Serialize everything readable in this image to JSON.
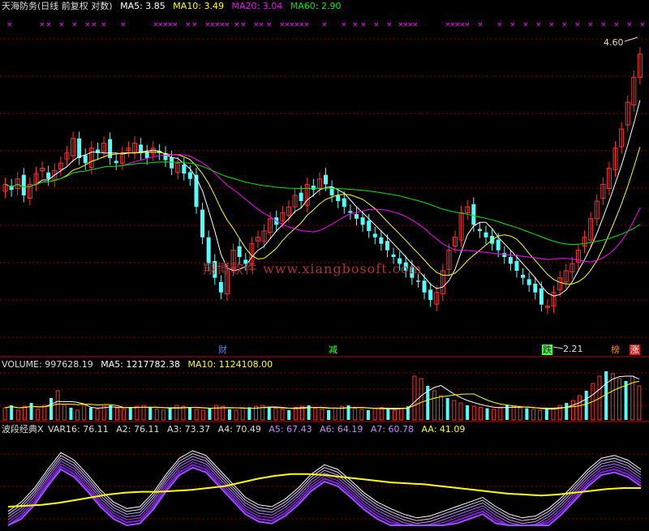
{
  "header": {
    "title": "天海防务(日线 前复权 对数)",
    "ma5": "MA5: 3.85",
    "ma10": "MA10: 3.49",
    "ma20": "MA20: 3.04",
    "ma60": "MA60: 2.90"
  },
  "volume_header": {
    "label": "VOLUME: 997628.19",
    "ma5": "MA5: 1217782.38",
    "ma10": "MA10: 1124108.00"
  },
  "indicator_header": {
    "name": "波段经典X",
    "var16": "VAR16: 76.11",
    "a2": "A2: 76.11",
    "a3": "A3: 73.37",
    "a4": "A4: 70.49",
    "a5": "A5: 67.43",
    "a6": "A6: 64.19",
    "a7": "A7: 60.78",
    "aa": "AA: 41.09"
  },
  "watermark": "翔博软件 www.xiangbosoft.com",
  "annotations": {
    "high": "4.60",
    "low": "2.21",
    "tags": [
      "财",
      "减",
      "跌",
      "榜",
      "涨"
    ]
  },
  "colors": {
    "up": "#ff3232",
    "down": "#54fcfc",
    "ma5": "#ffffff",
    "ma10": "#ffff00",
    "ma20": "#ff00ff",
    "ma60": "#00e600",
    "aa": "#ffff00",
    "grid": "#8b0000",
    "x_marker": "#ff00ff"
  },
  "chart_data": [
    {
      "type": "candlestick",
      "title": "天海防务(日线 前复权 对数)",
      "ylog": true,
      "y_marked_high": 4.6,
      "y_marked_low": 2.21,
      "closes_approx": [
        3.15,
        3.1,
        3.2,
        3.05,
        3.15,
        3.25,
        3.3,
        3.2,
        3.28,
        3.35,
        3.45,
        3.6,
        3.4,
        3.35,
        3.5,
        3.45,
        3.55,
        3.4,
        3.35,
        3.45,
        3.5,
        3.55,
        3.45,
        3.4,
        3.5,
        3.45,
        3.38,
        3.3,
        3.35,
        3.25,
        3.2,
        2.95,
        2.7,
        2.5,
        2.4,
        2.3,
        2.45,
        2.6,
        2.55,
        2.5,
        2.65,
        2.7,
        2.75,
        2.85,
        2.8,
        2.9,
        2.95,
        3.05,
        3.0,
        3.15,
        3.1,
        3.2,
        3.15,
        3.05,
        3.0,
        2.95,
        2.9,
        2.85,
        2.8,
        2.75,
        2.7,
        2.65,
        2.6,
        2.55,
        2.5,
        2.45,
        2.4,
        2.38,
        2.3,
        2.25,
        2.3,
        2.45,
        2.6,
        2.7,
        2.9,
        2.95,
        2.8,
        2.75,
        2.7,
        2.65,
        2.6,
        2.55,
        2.5,
        2.45,
        2.4,
        2.35,
        2.3,
        2.22,
        2.21,
        2.3,
        2.4,
        2.45,
        2.5,
        2.6,
        2.7,
        2.85,
        3.0,
        3.15,
        3.3,
        3.5,
        3.7,
        4.0,
        4.3,
        4.6
      ]
    },
    {
      "type": "bar",
      "title": "VOLUME",
      "values_approx": [
        0.25,
        0.3,
        0.2,
        0.28,
        0.35,
        0.22,
        0.3,
        0.45,
        0.6,
        0.3,
        0.25,
        0.2,
        0.3,
        0.25,
        0.22,
        0.28,
        0.3,
        0.24,
        0.22,
        0.25,
        0.28,
        0.3,
        0.26,
        0.22,
        0.2,
        0.24,
        0.3,
        0.28,
        0.26,
        0.22,
        0.2,
        0.24,
        0.3,
        0.28,
        0.22,
        0.2,
        0.24,
        0.26,
        0.28,
        0.3,
        0.25,
        0.24,
        0.22,
        0.2,
        0.26,
        0.28,
        0.3,
        0.24,
        0.22,
        0.2,
        0.25,
        0.28,
        0.3,
        0.24,
        0.22,
        0.2,
        0.24,
        0.26,
        0.22,
        0.2,
        0.24,
        0.28,
        0.9,
        0.85,
        0.7,
        0.6,
        0.5,
        0.45,
        0.4,
        0.35,
        0.3,
        0.28,
        0.26,
        0.24,
        0.22,
        0.26,
        0.3,
        0.28,
        0.25,
        0.24,
        0.22,
        0.2,
        0.22,
        0.24,
        0.3,
        0.35,
        0.4,
        0.5,
        0.6,
        0.75,
        0.9,
        1.0,
        0.95,
        0.85,
        0.8,
        0.9,
        0.7
      ]
    },
    {
      "type": "line",
      "title": "波段经典X",
      "series": [
        {
          "name": "VAR16",
          "values_approx": [
            15,
            25,
            40,
            60,
            78,
            70,
            55,
            38,
            25,
            18,
            20,
            35,
            55,
            72,
            80,
            75,
            60,
            45,
            30,
            22,
            20,
            28,
            40,
            55,
            65,
            60,
            48,
            35,
            25,
            18,
            12,
            8,
            10,
            15,
            20,
            25,
            30,
            20,
            12,
            8,
            10,
            18,
            30,
            45,
            60,
            72,
            75,
            70,
            60
          ]
        },
        {
          "name": "AA",
          "values_approx": [
            20,
            21,
            22,
            24,
            27,
            30,
            33,
            35,
            36,
            36,
            37,
            38,
            40,
            42,
            46,
            50,
            53,
            55,
            55,
            54,
            52,
            50,
            48,
            46,
            45,
            44,
            42,
            40,
            38,
            36,
            34,
            33,
            32,
            33,
            35,
            37,
            39,
            40,
            40
          ]
        }
      ]
    }
  ]
}
